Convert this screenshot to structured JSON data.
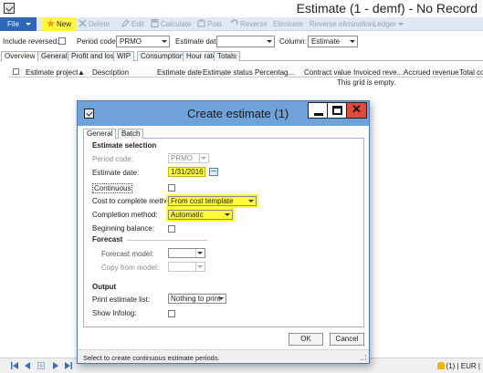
{
  "window": {
    "title": "Estimate (1 - demf) - No Record"
  },
  "ribbon": {
    "file": "File",
    "buttons": [
      {
        "label": "New",
        "enabled": true
      },
      {
        "label": "Delete",
        "enabled": false
      },
      {
        "label": "Edit",
        "enabled": false
      },
      {
        "label": "Calculate",
        "enabled": false
      },
      {
        "label": "Post",
        "enabled": false
      },
      {
        "label": "Reverse",
        "enabled": false
      },
      {
        "label": "Eliminate",
        "enabled": false
      },
      {
        "label": "Reverse elimination",
        "enabled": false
      },
      {
        "label": "Ledger",
        "enabled": false
      }
    ]
  },
  "filters": {
    "include_reversed": "Include reversed:",
    "period_code_label": "Period code:",
    "period_code_value": "PRMO",
    "estimate_date_label": "Estimate date:",
    "estimate_date_value": "",
    "column_label": "Column:",
    "column_value": "Estimate"
  },
  "tabs": [
    "Overview",
    "General",
    "Profit and loss",
    "WIP",
    "Consumption",
    "Hour rate",
    "Totals"
  ],
  "grid": {
    "columns": [
      "Estimate project",
      "Description",
      "Estimate date",
      "Estimate status",
      "Percentag...",
      "Contract value",
      "Invoiced reve...",
      "Accrued revenue",
      "Total cos"
    ],
    "empty_message": "This grid is empty."
  },
  "statusbar": {
    "right": "(1) | EUR |"
  },
  "dialog": {
    "title": "Create estimate (1)",
    "tabs": [
      "General",
      "Batch"
    ],
    "estimate_selection": {
      "heading": "Estimate selection",
      "period_code_label": "Period code:",
      "period_code_value": "PRMO",
      "estimate_date_label": "Estimate date:",
      "estimate_date_value": "1/31/2016",
      "continuous_label": "Continuous",
      "ctc_method_label": "Cost to complete method:",
      "ctc_method_value": "From cost template",
      "completion_method_label": "Completion method:",
      "completion_method_value": "Automatic",
      "beginning_balance_label": "Beginning balance:"
    },
    "forecast": {
      "heading": "Forecast",
      "forecast_model_label": "Forecast model:",
      "forecast_model_value": "",
      "copy_from_model_label": "Copy from model:",
      "copy_from_model_value": ""
    },
    "output": {
      "heading": "Output",
      "print_label": "Print estimate list:",
      "print_value": "Nothing to print",
      "infolog_label": "Show Infolog:"
    },
    "ok": "OK",
    "cancel": "Cancel",
    "status": "Select to create continuous estimate periods."
  },
  "colors": {
    "highlight": "#fff93a",
    "dialog_title": "#6ea2d8",
    "file_button": "#2d67b7",
    "ribbon": "#dfe8f5"
  }
}
